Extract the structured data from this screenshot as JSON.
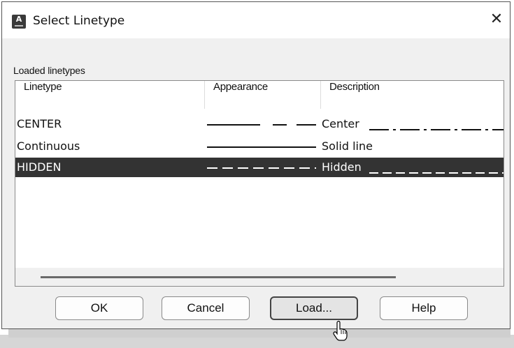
{
  "dialog": {
    "title": "Select Linetype",
    "app_icon_letter": "A",
    "close_glyph": "✕"
  },
  "group_label": "Loaded linetypes",
  "columns": [
    "Linetype",
    "Appearance",
    "Description"
  ],
  "rows": [
    {
      "name": "CENTER",
      "description": "Center",
      "pattern": "center",
      "selected": false
    },
    {
      "name": "Continuous",
      "description": "Solid line",
      "pattern": "solid",
      "selected": false
    },
    {
      "name": "HIDDEN",
      "description": "Hidden",
      "pattern": "hidden",
      "selected": true
    }
  ],
  "buttons": {
    "ok": "OK",
    "cancel": "Cancel",
    "load": "Load...",
    "help": "Help"
  },
  "colors": {
    "selection": "#333333",
    "dialog_bg": "#f0f0f0"
  },
  "icons": [
    "app-icon",
    "close-icon",
    "pointer-cursor-icon"
  ]
}
